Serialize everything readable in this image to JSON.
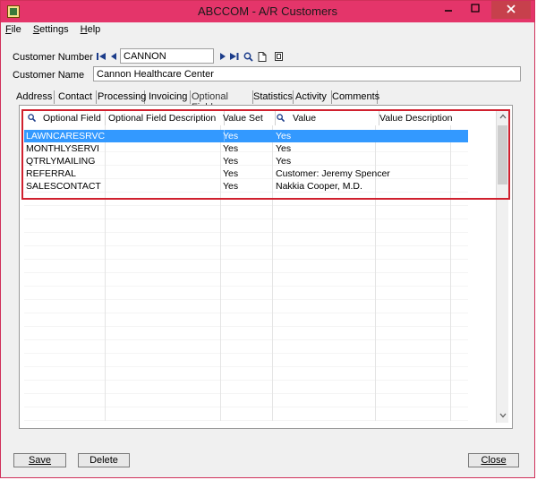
{
  "window": {
    "title": "ABCCOM - A/R Customers"
  },
  "menu": [
    {
      "label": "File",
      "underline": "F",
      "rest": "ile"
    },
    {
      "label": "Settings",
      "underline": "S",
      "rest": "ettings"
    },
    {
      "label": "Help",
      "underline": "H",
      "rest": "elp"
    }
  ],
  "customer": {
    "number_label": "Customer Number",
    "number_value": "CANNON",
    "name_label": "Customer Name",
    "name_value": "Cannon Healthcare Center"
  },
  "tabs": [
    "Address",
    "Contact",
    "Processing",
    "Invoicing",
    "Optional Fields",
    "Statistics",
    "Activity",
    "Comments"
  ],
  "active_tab": "Optional Fields",
  "grid": {
    "columns": [
      "Optional Field",
      "Optional Field Description",
      "Value Set",
      "Value",
      "Value Description"
    ],
    "rows": [
      {
        "field": "LAWNCARESRVC",
        "desc": "",
        "valueset": "Yes",
        "value": "Yes",
        "valuedesc": ""
      },
      {
        "field": "MONTHLYSERVI",
        "desc": "",
        "valueset": "Yes",
        "value": "Yes",
        "valuedesc": ""
      },
      {
        "field": "QTRLYMAILING",
        "desc": "",
        "valueset": "Yes",
        "value": "Yes",
        "valuedesc": ""
      },
      {
        "field": "REFERRAL",
        "desc": "",
        "valueset": "Yes",
        "value": "Customer: Jeremy Spencer",
        "valuedesc": ""
      },
      {
        "field": "SALESCONTACT",
        "desc": "",
        "valueset": "Yes",
        "value": "Nakkia Cooper, M.D.",
        "valuedesc": ""
      }
    ]
  },
  "buttons": {
    "save": "Save",
    "delete": "Delete",
    "close": "Close"
  },
  "colors": {
    "titlebar": "#e4356a",
    "selection": "#3399ff",
    "highlight_box": "#d0202e"
  }
}
